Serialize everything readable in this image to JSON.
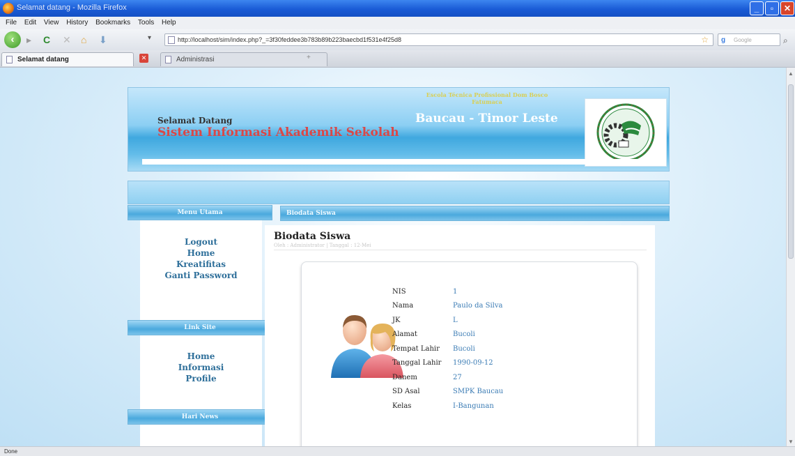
{
  "browser": {
    "window_title": "Selamat datang - Mozilla Firefox",
    "menu": [
      "File",
      "Edit",
      "View",
      "History",
      "Bookmarks",
      "Tools",
      "Help"
    ],
    "url": "http://localhost/sim/index.php?_=3f30feddee3b783b89b223baecbd1f531e4f25d8",
    "search_placeholder": "Google",
    "tabs": [
      "Selamat datang",
      "Administrasi"
    ],
    "status": "Done"
  },
  "header": {
    "welcome": "Selamat Datang",
    "system_name": "Sistem Informasi Akademik Sekolah",
    "school_line1": "Escola Técnica Profissional Dom Bosco",
    "school_line2": "Fatumaca",
    "place": "Baucau - Timor Leste"
  },
  "sidebar": {
    "menu_title": "Menu Utama",
    "menu_items": [
      "Logout",
      "Home",
      "Kreatifitas",
      "Ganti Password"
    ],
    "links_title": "Link Site",
    "link_items": [
      "Home",
      "Informasi",
      "Profile"
    ],
    "news_title": "Hari News"
  },
  "content": {
    "section_title": "Biodata Siswa",
    "heading": "Biodata Siswa",
    "meta": "Oleh : Administrator | Tanggal : 12-Mei",
    "rows": [
      {
        "label": "NIS",
        "value": "1"
      },
      {
        "label": "Nama",
        "value": "Paulo da Silva"
      },
      {
        "label": "JK",
        "value": "L"
      },
      {
        "label": "Alamat",
        "value": "Bucoli"
      },
      {
        "label": "Tempat Lahir",
        "value": "Bucoli"
      },
      {
        "label": "Tanggal Lahir",
        "value": "1990-09-12"
      },
      {
        "label": "Danem",
        "value": "27"
      },
      {
        "label": "SD Asal",
        "value": "SMPK Baucau"
      },
      {
        "label": "Kelas",
        "value": "I-Bangunan"
      }
    ]
  },
  "colors": {
    "system_name": "#d94848",
    "link": "#2e6f9a",
    "value": "#3a7bb4",
    "header_blue": "#3fa8df"
  }
}
